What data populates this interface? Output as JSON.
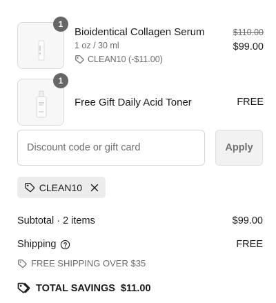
{
  "items": [
    {
      "quantity": "1",
      "title": "Bioidentical Collagen Serum",
      "variant": "1 oz / 30 ml",
      "discount": "CLEAN10 (-$11.00)",
      "original_price": "$110.00",
      "price": "$99.00"
    },
    {
      "quantity": "1",
      "title": "Free Gift Daily Acid Toner",
      "price": "FREE"
    }
  ],
  "discount_field": {
    "placeholder": "Discount code or gift card",
    "apply_label": "Apply"
  },
  "applied_code": "CLEAN10",
  "summary": {
    "subtotal_label": "Subtotal · 2 items",
    "subtotal_value": "$99.00",
    "shipping_label": "Shipping",
    "shipping_value": "FREE",
    "shipping_note": "FREE SHIPPING OVER $35",
    "savings_label": "TOTAL SAVINGS",
    "savings_value": "$11.00"
  },
  "colors": {
    "badge": "#666666",
    "muted_text": "#6b6b6b",
    "chip_bg": "#ececec",
    "apply_bg": "#f2f2f2"
  },
  "icons": [
    "serum-bottle-image",
    "toner-bottle-image",
    "tag-icon",
    "close-icon",
    "help-circle-icon",
    "tags-icon"
  ]
}
